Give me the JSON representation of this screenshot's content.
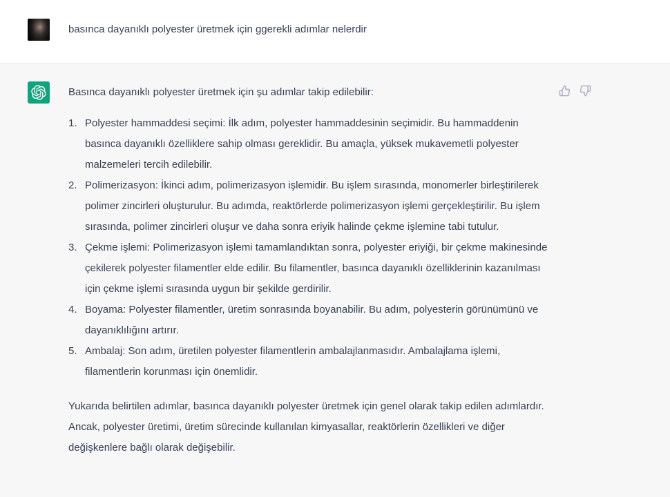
{
  "user_message": {
    "text": "basınca dayanıklı polyester üretmek için ggerekli adımlar nelerdir"
  },
  "assistant_message": {
    "intro": "Basınca dayanıklı polyester üretmek için şu adımlar takip edilebilir:",
    "steps": [
      {
        "number": "1.",
        "text": "Polyester hammaddesi seçimi: İlk adım, polyester hammaddesinin seçimidir. Bu hammaddenin basınca dayanıklı özelliklere sahip olması gereklidir. Bu amaçla, yüksek mukavemetli polyester malzemeleri tercih edilebilir."
      },
      {
        "number": "2.",
        "text": "Polimerizasyon: İkinci adım, polimerizasyon işlemidir. Bu işlem sırasında, monomerler birleştirilerek polimer zincirleri oluşturulur. Bu adımda, reaktörlerde polimerizasyon işlemi gerçekleştirilir. Bu işlem sırasında, polimer zincirleri oluşur ve daha sonra eriyik halinde çekme işlemine tabi tutulur."
      },
      {
        "number": "3.",
        "text": "Çekme işlemi: Polimerizasyon işlemi tamamlandıktan sonra, polyester eriyiği, bir çekme makinesinde çekilerek polyester filamentler elde edilir. Bu filamentler, basınca dayanıklı özelliklerinin kazanılması için çekme işlemi sırasında uygun bir şekilde gerdirilir."
      },
      {
        "number": "4.",
        "text": "Boyama: Polyester filamentler, üretim sonrasında boyanabilir. Bu adım, polyesterin görünümünü ve dayanıklılığını artırır."
      },
      {
        "number": "5.",
        "text": "Ambalaj: Son adım, üretilen polyester filamentlerin ambalajlanmasıdır. Ambalajlama işlemi, filamentlerin korunması için önemlidir."
      }
    ],
    "outro": "Yukarıda belirtilen adımlar, basınca dayanıklı polyester üretmek için genel olarak takip edilen adımlardır. Ancak, polyester üretimi, üretim sürecinde kullanılan kimyasallar, reaktörlerin özellikleri ve diğer değişkenlere bağlı olarak değişebilir."
  },
  "icons": {
    "assistant_avatar": "openai-logo-icon",
    "thumbs_up": "thumbs-up-icon",
    "thumbs_down": "thumbs-down-icon"
  },
  "colors": {
    "assistant_avatar_bg": "#10a37f",
    "assistant_row_bg": "#f7f7f8",
    "user_row_bg": "#ffffff",
    "text": "#374151",
    "icon": "#acacbe"
  }
}
